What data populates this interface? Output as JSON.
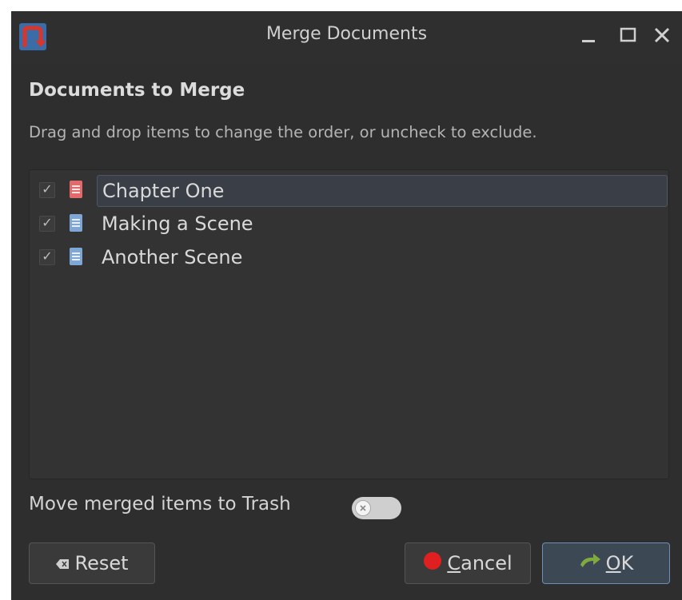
{
  "window": {
    "title": "Merge Documents"
  },
  "dialog": {
    "heading": "Documents to Merge",
    "subtitle": "Drag and drop items to change the order, or uncheck to exclude."
  },
  "items": [
    {
      "label": "Chapter One",
      "checked": true,
      "icon": "red-document-icon",
      "selected": true
    },
    {
      "label": "Making a Scene",
      "checked": true,
      "icon": "blue-document-icon",
      "selected": false
    },
    {
      "label": "Another Scene",
      "checked": true,
      "icon": "blue-document-icon",
      "selected": false
    }
  ],
  "check_glyph": "✓",
  "trash": {
    "label": "Move merged items to Trash",
    "enabled": false
  },
  "buttons": {
    "reset": "Reset",
    "cancel_accel": "C",
    "cancel_rest": "ancel",
    "ok_accel": "O",
    "ok_rest": "K"
  },
  "colors": {
    "background": "#2e2e2e",
    "accent": "#6b8fb5",
    "cancel_icon": "#e02020",
    "ok_icon": "#7faa3e"
  }
}
